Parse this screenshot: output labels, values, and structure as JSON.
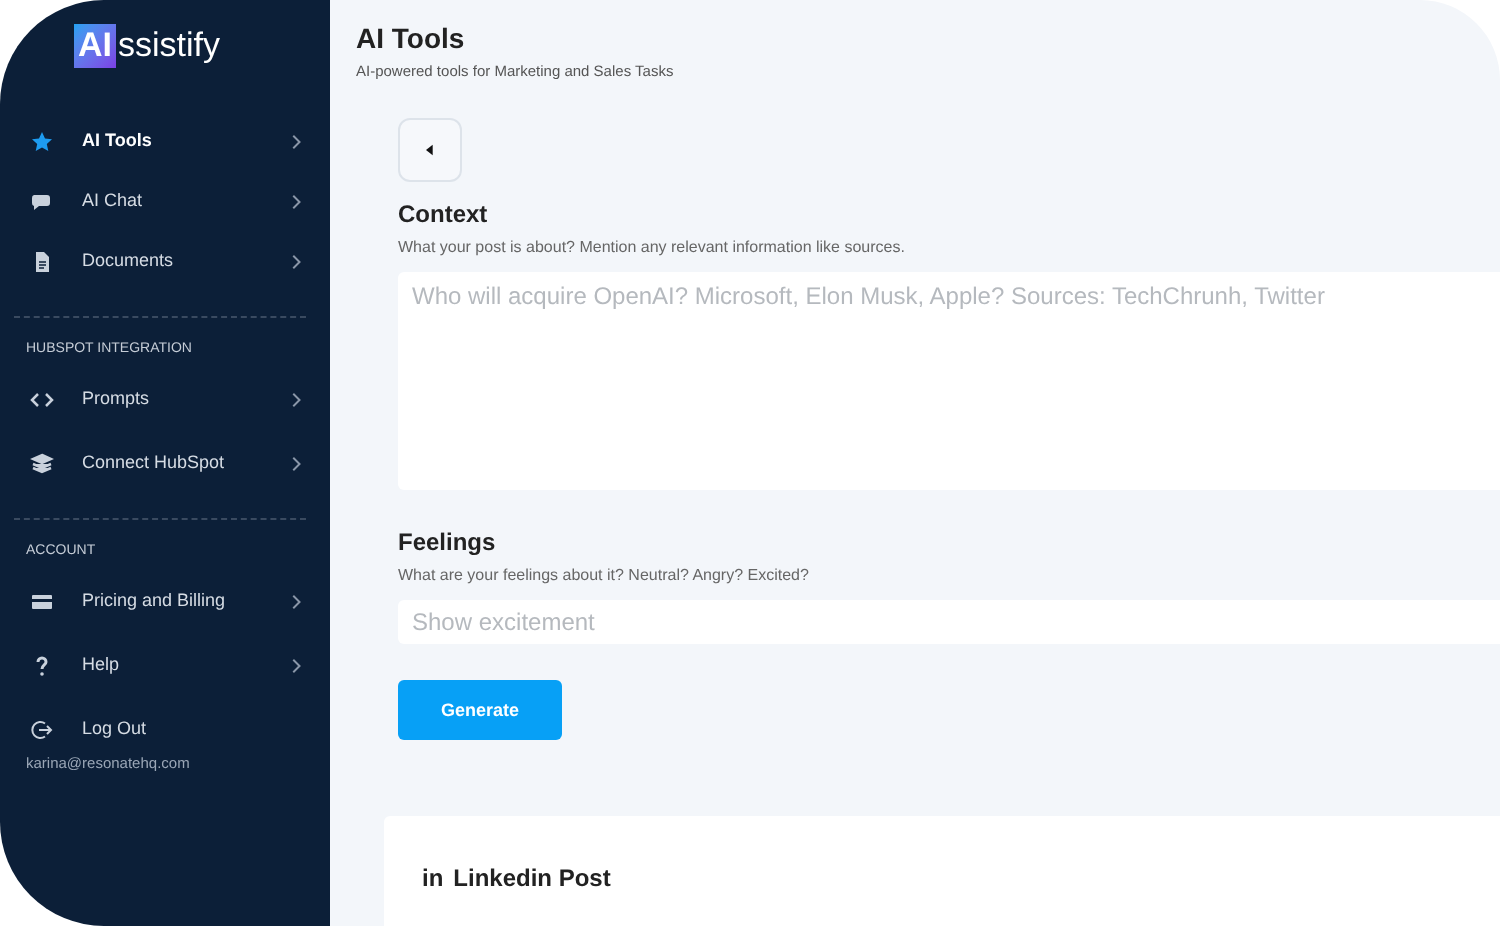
{
  "brand": {
    "badge": "AI",
    "rest": "ssistify"
  },
  "sidebar": {
    "sections": [
      {
        "items": [
          {
            "label": "AI Tools",
            "selected": true,
            "kind": "nav"
          },
          {
            "label": "AI Chat",
            "selected": false,
            "kind": "nav"
          },
          {
            "label": "Documents",
            "selected": false,
            "kind": "nav"
          }
        ]
      },
      {
        "header": "HUBSPOT INTEGRATION",
        "items": [
          {
            "label": "Prompts",
            "selected": false,
            "kind": "nav"
          },
          {
            "label": "Connect HubSpot",
            "selected": false,
            "kind": "nav"
          }
        ]
      },
      {
        "header": "ACCOUNT",
        "items": [
          {
            "label": "Pricing and Billing",
            "selected": false,
            "kind": "nav"
          },
          {
            "label": "Help",
            "selected": false,
            "kind": "nav"
          },
          {
            "label": "Log Out",
            "selected": false,
            "kind": "action"
          }
        ]
      }
    ],
    "email": "karina@resonatehq.com"
  },
  "page": {
    "title": "AI Tools",
    "subtitle": "AI-powered tools for Marketing and Sales Tasks"
  },
  "form": {
    "fields": [
      {
        "label": "Context",
        "hint": "What your post is about? Mention any relevant information like sources.",
        "placeholder": "Who will acquire OpenAI? Microsoft, Elon Musk, Apple? Sources: TechChrunh, Twitter",
        "kind": "textarea"
      },
      {
        "label": "Feelings",
        "hint": "What are your feelings about it? Neutral? Angry? Excited?",
        "placeholder": "Show excitement",
        "kind": "input"
      }
    ],
    "button": "Generate"
  },
  "result_card": {
    "icon_text": "in",
    "title": "Linkedin Post"
  }
}
